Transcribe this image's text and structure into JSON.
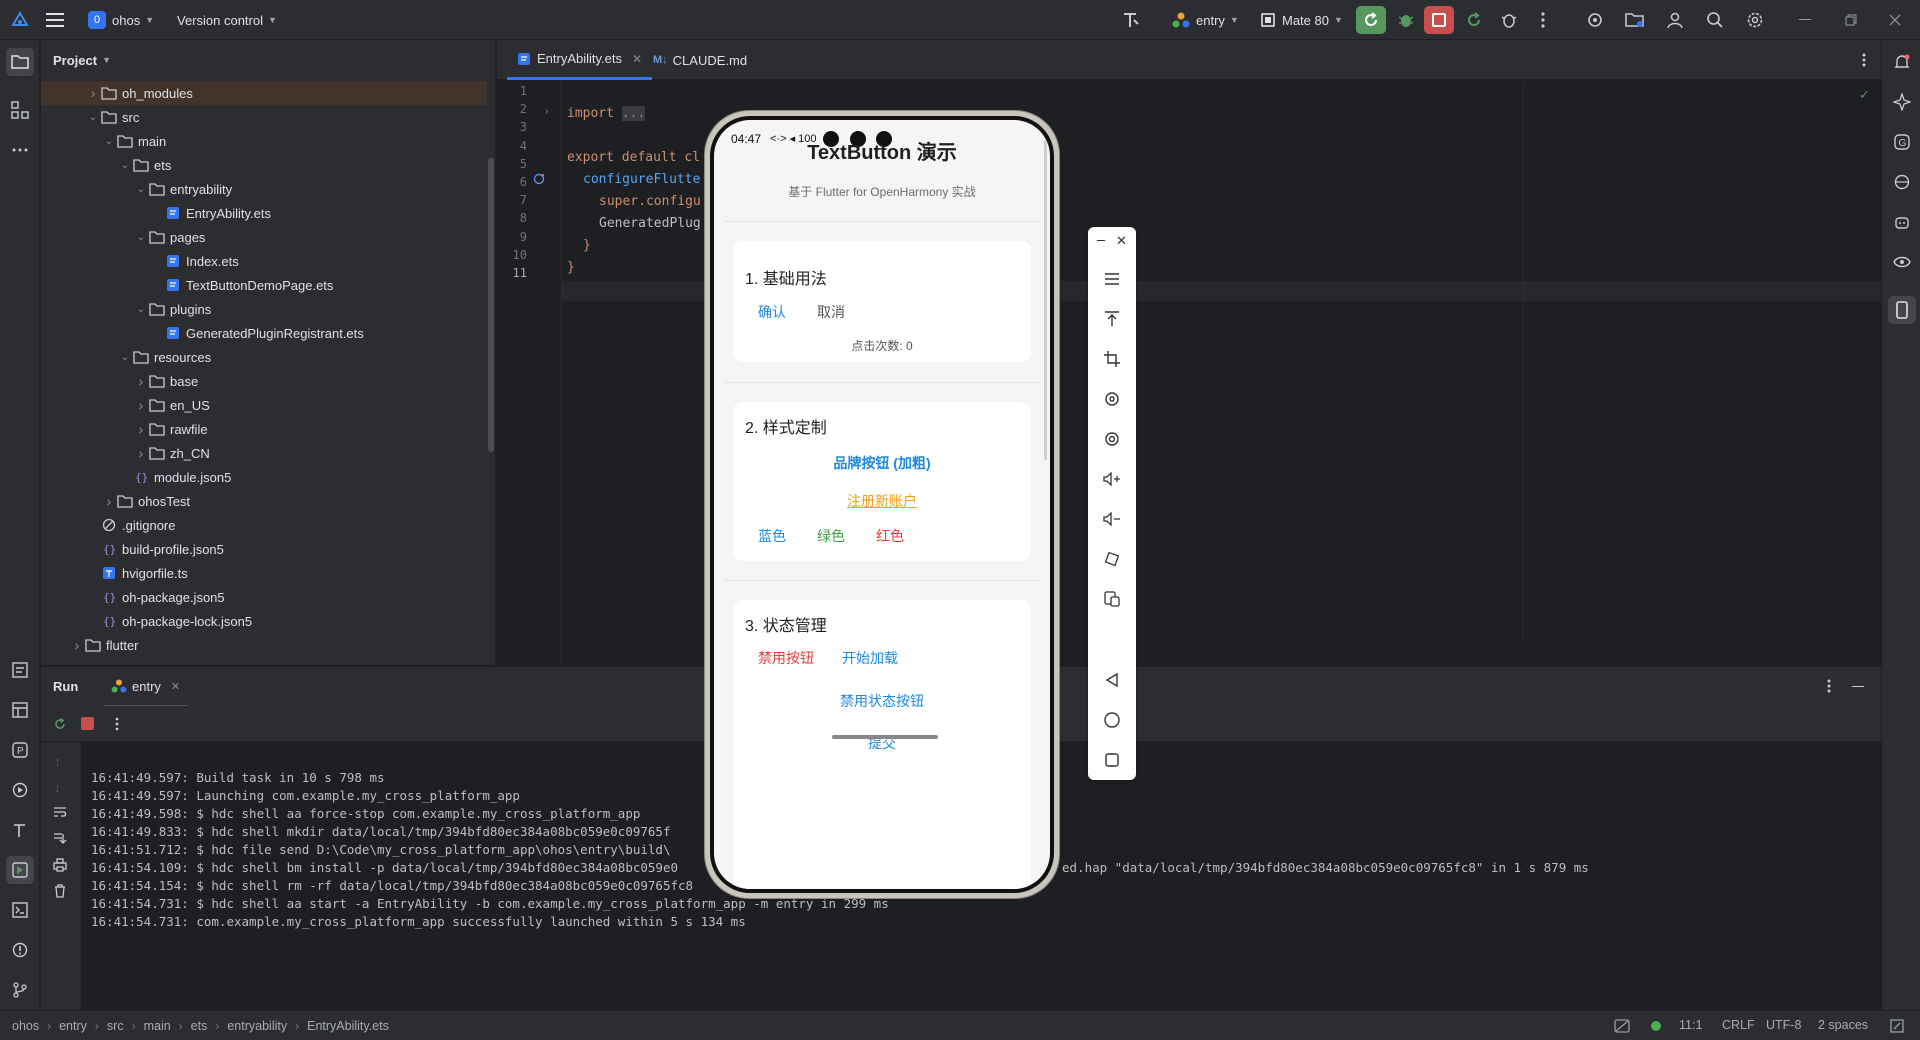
{
  "titlebar": {
    "project_badge": "0",
    "project_name": "ohos",
    "vcs": "Version control",
    "run_config": "entry",
    "device": "Mate 80"
  },
  "project_panel": {
    "title": "Project",
    "tree": [
      {
        "label": "oh_modules",
        "depth": 3,
        "type": "folder",
        "arrow": "right",
        "selected": true
      },
      {
        "label": "src",
        "depth": 3,
        "type": "folder",
        "arrow": "down"
      },
      {
        "label": "main",
        "depth": 4,
        "type": "folder",
        "arrow": "down"
      },
      {
        "label": "ets",
        "depth": 5,
        "type": "folder",
        "arrow": "down"
      },
      {
        "label": "entryability",
        "depth": 6,
        "type": "folder",
        "arrow": "down"
      },
      {
        "label": "EntryAbility.ets",
        "depth": 7,
        "type": "ets"
      },
      {
        "label": "pages",
        "depth": 6,
        "type": "folder",
        "arrow": "down"
      },
      {
        "label": "Index.ets",
        "depth": 7,
        "type": "ets"
      },
      {
        "label": "TextButtonDemoPage.ets",
        "depth": 7,
        "type": "ets"
      },
      {
        "label": "plugins",
        "depth": 6,
        "type": "folder",
        "arrow": "down"
      },
      {
        "label": "GeneratedPluginRegistrant.ets",
        "depth": 7,
        "type": "ets"
      },
      {
        "label": "resources",
        "depth": 5,
        "type": "folder",
        "arrow": "down"
      },
      {
        "label": "base",
        "depth": 6,
        "type": "folder",
        "arrow": "right"
      },
      {
        "label": "en_US",
        "depth": 6,
        "type": "folder",
        "arrow": "right"
      },
      {
        "label": "rawfile",
        "depth": 6,
        "type": "folder",
        "arrow": "right"
      },
      {
        "label": "zh_CN",
        "depth": 6,
        "type": "folder",
        "arrow": "right"
      },
      {
        "label": "module.json5",
        "depth": 5,
        "type": "json"
      },
      {
        "label": "ohosTest",
        "depth": 4,
        "type": "folder",
        "arrow": "right"
      },
      {
        "label": ".gitignore",
        "depth": 3,
        "type": "ignore"
      },
      {
        "label": "build-profile.json5",
        "depth": 3,
        "type": "json"
      },
      {
        "label": "hvigorfile.ts",
        "depth": 3,
        "type": "ts"
      },
      {
        "label": "oh-package.json5",
        "depth": 3,
        "type": "json"
      },
      {
        "label": "oh-package-lock.json5",
        "depth": 3,
        "type": "json"
      },
      {
        "label": "flutter",
        "depth": 2,
        "type": "folder",
        "arrow": "right"
      }
    ]
  },
  "editor": {
    "tabs": [
      {
        "label": "EntryAbility.ets",
        "active": true
      },
      {
        "label": "CLAUDE.md",
        "active": false
      }
    ],
    "lines": [
      "1",
      "2",
      "3",
      "4",
      "5",
      "6",
      "7",
      "8",
      "9",
      "10",
      "11"
    ],
    "code": {
      "l2_kw": "import",
      "l2_fold": "...",
      "l5": "export default cl",
      "l6": "configureFlutte",
      "l7": "super.configu",
      "l8": "GeneratedPlug",
      "l9": "}",
      "l10": "}"
    }
  },
  "run_panel": {
    "title": "Run",
    "tab": "entry",
    "logs": [
      "16:41:49.597: Build task in 10 s 798 ms",
      "16:41:49.597: Launching com.example.my_cross_platform_app",
      "16:41:49.598: $ hdc shell aa force-stop com.example.my_cross_platform_app",
      "16:41:49.833: $ hdc shell mkdir data/local/tmp/394bfd80ec384a08bc059e0c09765f",
      "16:41:51.712: $ hdc file send D:\\Code\\my_cross_platform_app\\ohos\\entry\\build\\",
      "16:41:54.109: $ hdc shell bm install -p data/local/tmp/394bfd80ec384a08bc059e0",
      "16:41:54.154: $ hdc shell rm -rf data/local/tmp/394bfd80ec384a08bc059e0c09765fc8",
      "16:41:54.731: $ hdc shell aa start -a EntryAbility -b com.example.my_cross_platform_app -m entry in 299 ms",
      "16:41:54.731: com.example.my_cross_platform_app successfully launched within 5 s 134 ms"
    ],
    "log_overflow": "ed.hap \"data/local/tmp/394bfd80ec384a08bc059e0c09765fc8\" in 1 s 879 ms"
  },
  "phone": {
    "time": "04:47",
    "status_icons": "<·> ◂ 100",
    "app_title": "TextButton 演示",
    "subtitle": "基于 Flutter for OpenHarmony 实战",
    "card1": {
      "title": "1. 基础用法",
      "confirm": "确认",
      "cancel": "取消",
      "count": "点击次数: 0"
    },
    "card2": {
      "title": "2. 样式定制",
      "brand": "品牌按钮 (加粗)",
      "register": "注册新账户",
      "blue": "蓝色",
      "green": "绿色",
      "red": "红色"
    },
    "card3": {
      "title": "3. 状态管理",
      "disable": "禁用按钮",
      "load": "开始加载",
      "disabled_state": "禁用状态按钮",
      "cut_off": "提交"
    }
  },
  "statusbar": {
    "crumbs": [
      "ohos",
      "entry",
      "src",
      "main",
      "ets",
      "entryability",
      "EntryAbility.ets"
    ],
    "position": "11:1",
    "line_sep": "CRLF",
    "encoding": "UTF-8",
    "indent": "2 spaces"
  },
  "colors": {
    "accent": "#3574f0",
    "phone_blue": "#1e88e5",
    "phone_green": "#43a047",
    "phone_red": "#e53935",
    "phone_orange": "#f39c12"
  }
}
